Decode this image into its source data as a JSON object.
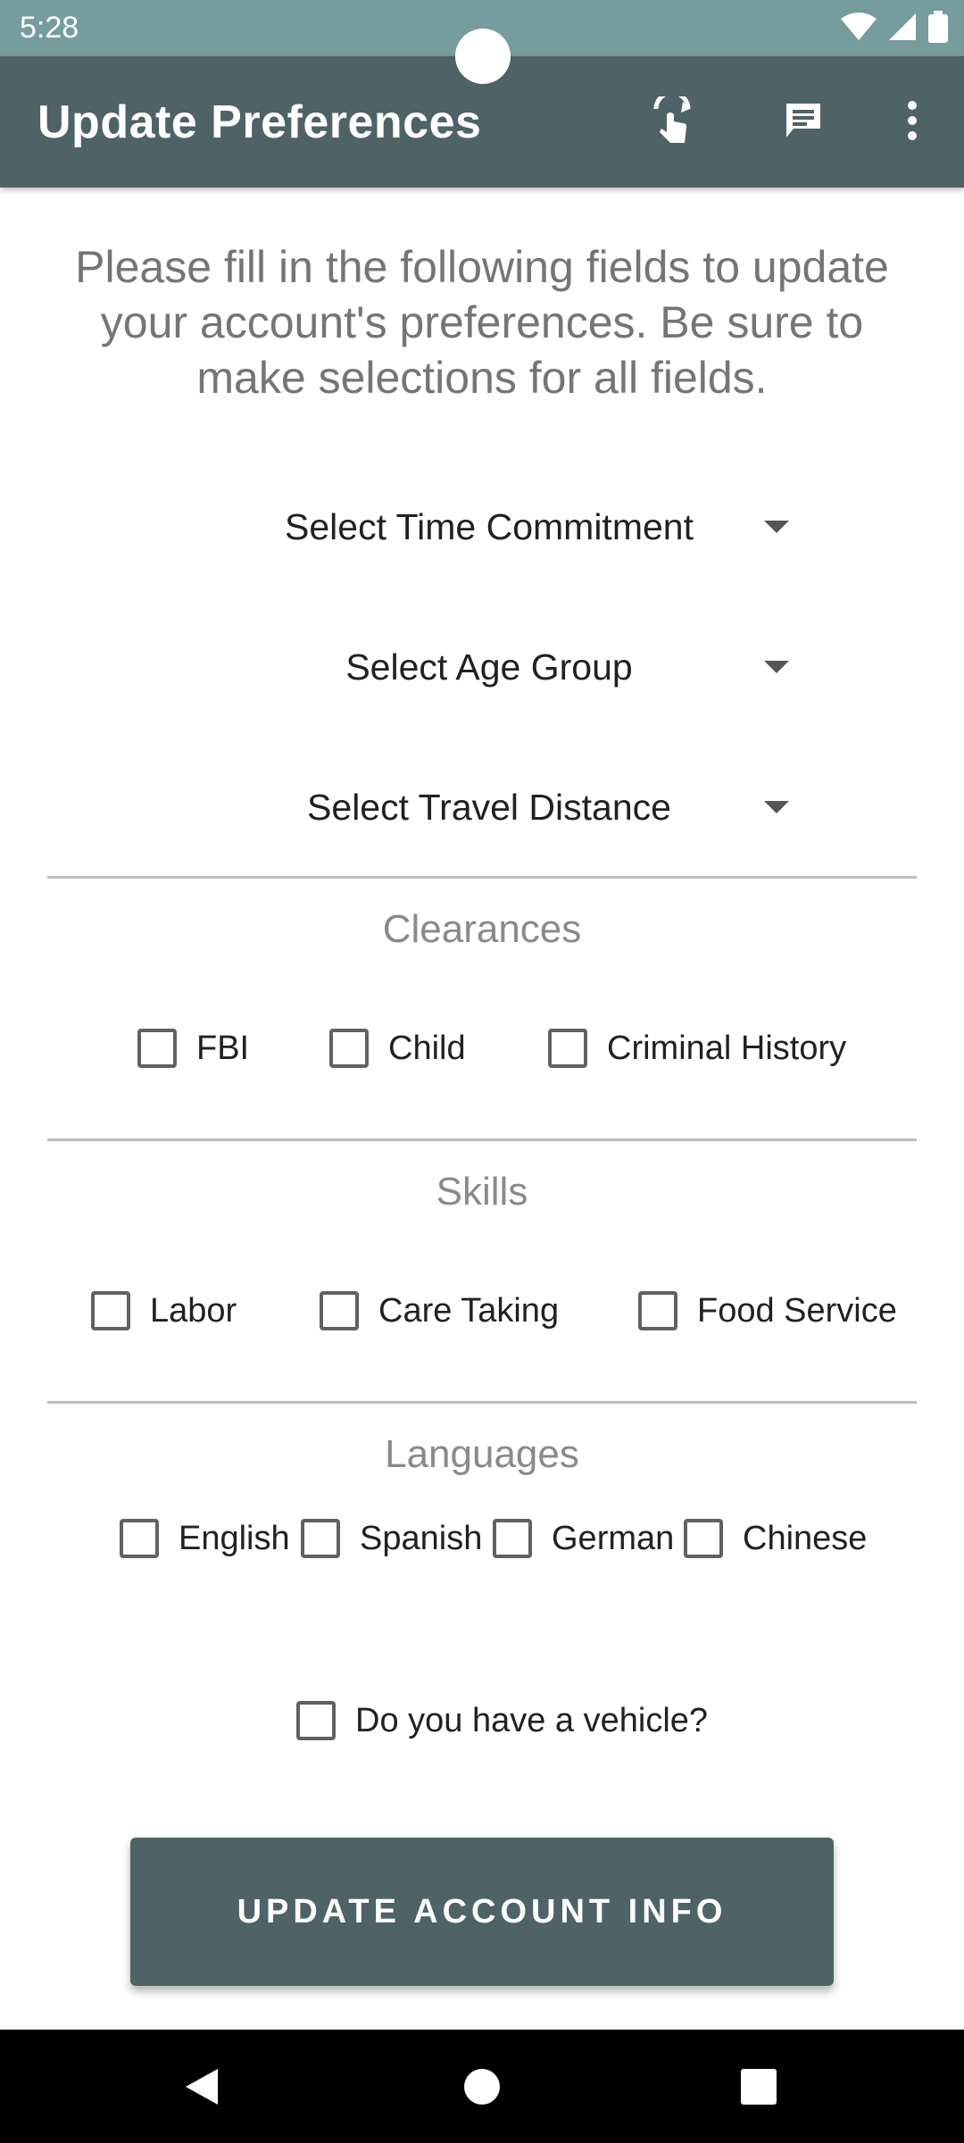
{
  "status_bar": {
    "time": "5:28"
  },
  "app_bar": {
    "title": "Update Preferences",
    "actions": [
      "touch-app-icon",
      "message-icon",
      "overflow-menu-icon"
    ]
  },
  "intro_text": "Please fill in the following fields to update your account's preferences. Be sure to make selections for all fields.",
  "spinners": {
    "time_commitment": "Select Time Commitment",
    "age_group": "Select Age Group",
    "travel_distance": "Select Travel Distance"
  },
  "clearances": {
    "title": "Clearances",
    "options": [
      "FBI",
      "Child",
      "Criminal History"
    ]
  },
  "skills": {
    "title": "Skills",
    "options": [
      "Labor",
      "Care Taking",
      "Food Service"
    ]
  },
  "languages": {
    "title": "Languages",
    "options": [
      "English",
      "Spanish",
      "German",
      "Chinese"
    ]
  },
  "vehicle": {
    "label": "Do you have a vehicle?"
  },
  "submit_button": {
    "label": "UPDATE ACCOUNT INFO"
  },
  "colors": {
    "status_bar": "#779C9E",
    "app_bar": "#4F6265",
    "button": "#4F6265"
  }
}
